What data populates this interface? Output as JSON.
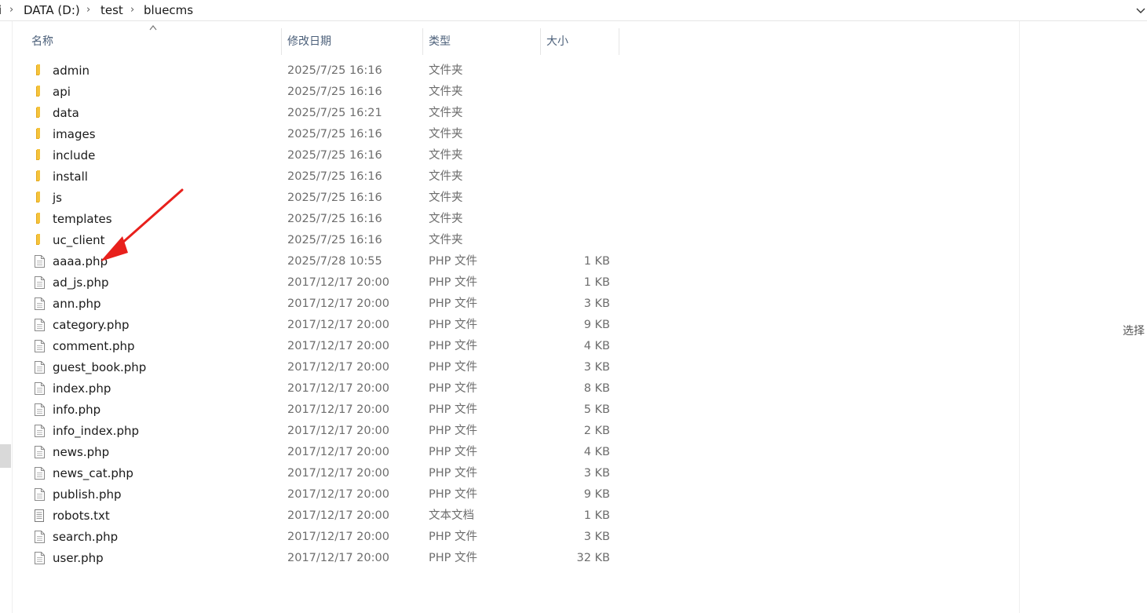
{
  "breadcrumb": {
    "items": [
      "i",
      "DATA (D:)",
      "test",
      "bluecms"
    ],
    "separator": "›"
  },
  "columns": {
    "name": "名称",
    "date": "修改日期",
    "type": "类型",
    "size": "大小"
  },
  "files": [
    {
      "name": "admin",
      "date": "2025/7/25 16:16",
      "type": "文件夹",
      "size": "",
      "kind": "folder"
    },
    {
      "name": "api",
      "date": "2025/7/25 16:16",
      "type": "文件夹",
      "size": "",
      "kind": "folder"
    },
    {
      "name": "data",
      "date": "2025/7/25 16:21",
      "type": "文件夹",
      "size": "",
      "kind": "folder"
    },
    {
      "name": "images",
      "date": "2025/7/25 16:16",
      "type": "文件夹",
      "size": "",
      "kind": "folder"
    },
    {
      "name": "include",
      "date": "2025/7/25 16:16",
      "type": "文件夹",
      "size": "",
      "kind": "folder"
    },
    {
      "name": "install",
      "date": "2025/7/25 16:16",
      "type": "文件夹",
      "size": "",
      "kind": "folder"
    },
    {
      "name": "js",
      "date": "2025/7/25 16:16",
      "type": "文件夹",
      "size": "",
      "kind": "folder"
    },
    {
      "name": "templates",
      "date": "2025/7/25 16:16",
      "type": "文件夹",
      "size": "",
      "kind": "folder"
    },
    {
      "name": "uc_client",
      "date": "2025/7/25 16:16",
      "type": "文件夹",
      "size": "",
      "kind": "folder"
    },
    {
      "name": "aaaa.php",
      "date": "2025/7/28 10:55",
      "type": "PHP 文件",
      "size": "1 KB",
      "kind": "file"
    },
    {
      "name": "ad_js.php",
      "date": "2017/12/17 20:00",
      "type": "PHP 文件",
      "size": "1 KB",
      "kind": "file"
    },
    {
      "name": "ann.php",
      "date": "2017/12/17 20:00",
      "type": "PHP 文件",
      "size": "3 KB",
      "kind": "file"
    },
    {
      "name": "category.php",
      "date": "2017/12/17 20:00",
      "type": "PHP 文件",
      "size": "9 KB",
      "kind": "file"
    },
    {
      "name": "comment.php",
      "date": "2017/12/17 20:00",
      "type": "PHP 文件",
      "size": "4 KB",
      "kind": "file"
    },
    {
      "name": "guest_book.php",
      "date": "2017/12/17 20:00",
      "type": "PHP 文件",
      "size": "3 KB",
      "kind": "file"
    },
    {
      "name": "index.php",
      "date": "2017/12/17 20:00",
      "type": "PHP 文件",
      "size": "8 KB",
      "kind": "file"
    },
    {
      "name": "info.php",
      "date": "2017/12/17 20:00",
      "type": "PHP 文件",
      "size": "5 KB",
      "kind": "file"
    },
    {
      "name": "info_index.php",
      "date": "2017/12/17 20:00",
      "type": "PHP 文件",
      "size": "2 KB",
      "kind": "file"
    },
    {
      "name": "news.php",
      "date": "2017/12/17 20:00",
      "type": "PHP 文件",
      "size": "4 KB",
      "kind": "file"
    },
    {
      "name": "news_cat.php",
      "date": "2017/12/17 20:00",
      "type": "PHP 文件",
      "size": "3 KB",
      "kind": "file"
    },
    {
      "name": "publish.php",
      "date": "2017/12/17 20:00",
      "type": "PHP 文件",
      "size": "9 KB",
      "kind": "file"
    },
    {
      "name": "robots.txt",
      "date": "2017/12/17 20:00",
      "type": "文本文档",
      "size": "1 KB",
      "kind": "text"
    },
    {
      "name": "search.php",
      "date": "2017/12/17 20:00",
      "type": "PHP 文件",
      "size": "3 KB",
      "kind": "file"
    },
    {
      "name": "user.php",
      "date": "2017/12/17 20:00",
      "type": "PHP 文件",
      "size": "32 KB",
      "kind": "file"
    }
  ],
  "details_pane": {
    "text": "选择"
  },
  "colors": {
    "folder": "#f5c33b",
    "folder_dark": "#e3a921",
    "header_text": "#4c607a",
    "annotation": "#e8201c"
  },
  "icons": {
    "folder": "folder-icon",
    "file": "php-file-icon",
    "text": "text-file-icon",
    "sort": "sort-up-icon",
    "chevron": "chevron-down-icon"
  }
}
